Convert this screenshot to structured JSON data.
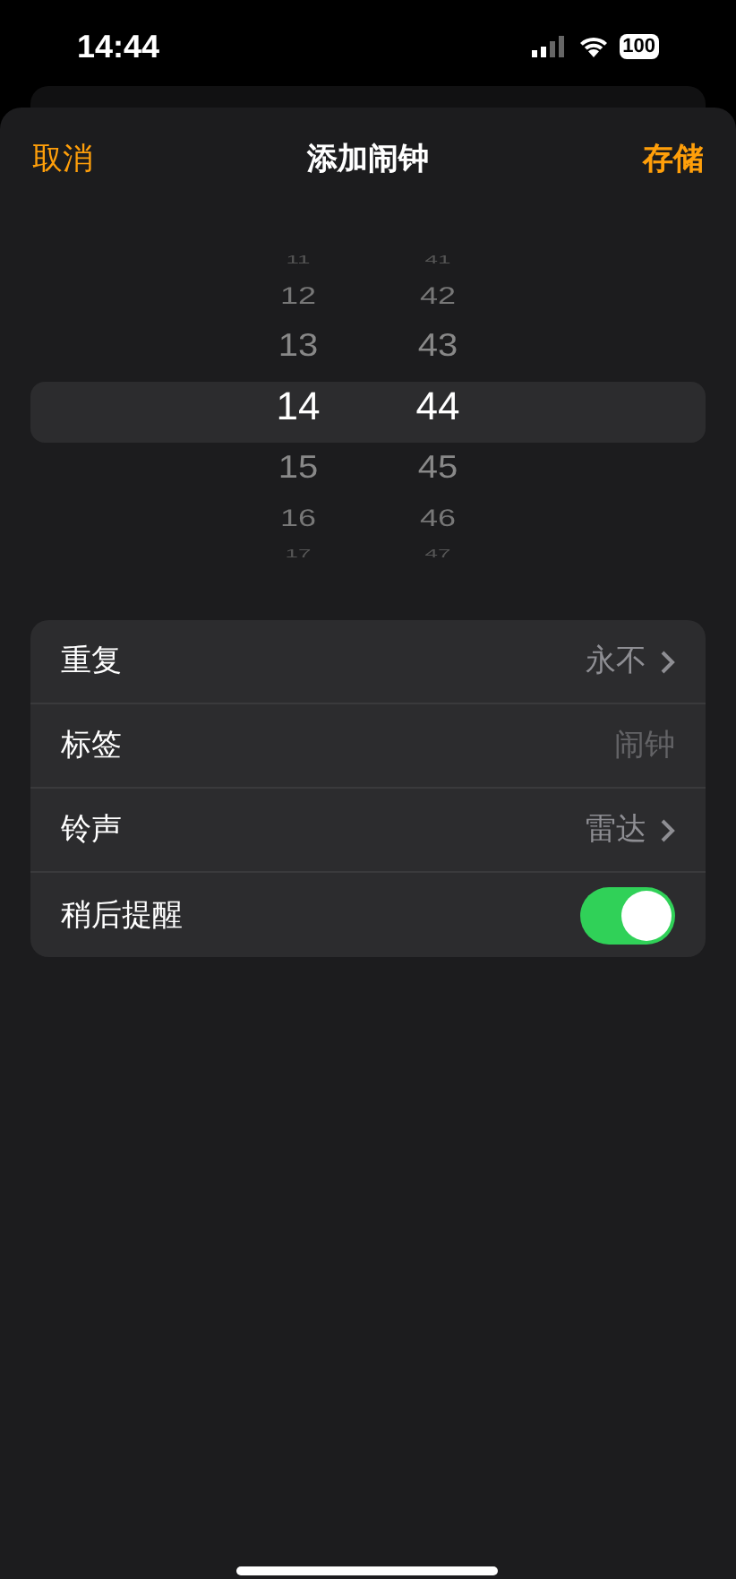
{
  "status_bar": {
    "time": "14:44",
    "battery": "100"
  },
  "nav": {
    "cancel": "取消",
    "title": "添加闹钟",
    "save": "存储"
  },
  "picker": {
    "hours": [
      {
        "value": "11",
        "selected": false
      },
      {
        "value": "12",
        "selected": false
      },
      {
        "value": "13",
        "selected": false
      },
      {
        "value": "14",
        "selected": true
      },
      {
        "value": "15",
        "selected": false
      },
      {
        "value": "16",
        "selected": false
      },
      {
        "value": "17",
        "selected": false
      }
    ],
    "minutes": [
      {
        "value": "41",
        "selected": false
      },
      {
        "value": "42",
        "selected": false
      },
      {
        "value": "43",
        "selected": false
      },
      {
        "value": "44",
        "selected": true
      },
      {
        "value": "45",
        "selected": false
      },
      {
        "value": "46",
        "selected": false
      },
      {
        "value": "47",
        "selected": false
      }
    ]
  },
  "settings": [
    {
      "kind": "link",
      "label": "重复",
      "value": "永不"
    },
    {
      "kind": "field",
      "label": "标签",
      "placeholder": "闹钟"
    },
    {
      "kind": "link",
      "label": "铃声",
      "value": "雷达"
    },
    {
      "kind": "toggle",
      "label": "稍后提醒",
      "on": true
    }
  ]
}
